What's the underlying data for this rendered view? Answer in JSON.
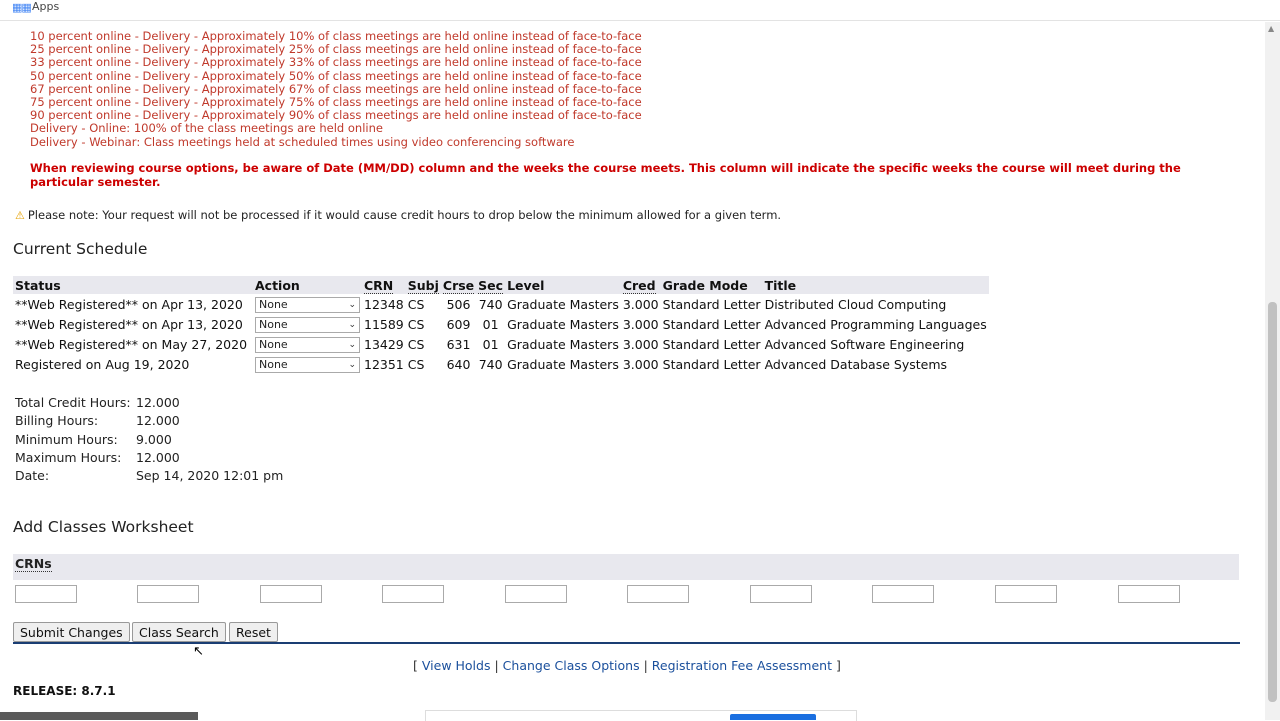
{
  "bookmarks_bar": {
    "apps_label": "Apps"
  },
  "delivery_lines": [
    "10 percent online - Delivery - Approximately 10% of class meetings are held online instead of face-to-face",
    "25 percent online - Delivery - Approximately 25% of class meetings are held online instead of face-to-face",
    "33 percent online - Delivery - Approximately 33% of class meetings are held online instead of face-to-face",
    "50 percent online - Delivery - Approximately 50% of class meetings are held online instead of face-to-face",
    "67 percent online - Delivery - Approximately 67% of class meetings are held online instead of face-to-face",
    "75 percent online - Delivery - Approximately 75% of class meetings are held online instead of face-to-face",
    "90 percent online - Delivery - Approximately 90% of class meetings are held online instead of face-to-face",
    "Delivery - Online: 100% of the class meetings are held online",
    "Delivery - Webinar: Class meetings held at scheduled times using video conferencing software"
  ],
  "warning_bold": "When reviewing course options, be aware of Date (MM/DD) column and the weeks the course meets. This column will indicate the specific weeks the course will meet during the particular semester.",
  "note": "Please note: Your request will not be processed if it would cause credit hours to drop below the minimum allowed for a given term.",
  "current_schedule": {
    "heading": "Current Schedule",
    "columns": [
      "Status",
      "Action",
      "CRN",
      "Subj",
      "Crse",
      "Sec",
      "Level",
      "Cred",
      "Grade Mode",
      "Title"
    ],
    "rows": [
      {
        "status": "**Web Registered** on Apr 13, 2020",
        "action": "None",
        "crn": "12348",
        "subj": "CS",
        "crse": "506",
        "sec": "740",
        "level": "Graduate Masters",
        "cred": "3.000",
        "grade_mode": "Standard Letter",
        "title": "Distributed Cloud Computing"
      },
      {
        "status": "**Web Registered** on Apr 13, 2020",
        "action": "None",
        "crn": "11589",
        "subj": "CS",
        "crse": "609",
        "sec": "01",
        "level": "Graduate Masters",
        "cred": "3.000",
        "grade_mode": "Standard Letter",
        "title": "Advanced Programming Languages"
      },
      {
        "status": "**Web Registered** on May 27, 2020",
        "action": "None",
        "crn": "13429",
        "subj": "CS",
        "crse": "631",
        "sec": "01",
        "level": "Graduate Masters",
        "cred": "3.000",
        "grade_mode": "Standard Letter",
        "title": "Advanced Software Engineering"
      },
      {
        "status": "Registered on Aug 19, 2020",
        "action": "None",
        "crn": "12351",
        "subj": "CS",
        "crse": "640",
        "sec": "740",
        "level": "Graduate Masters",
        "cred": "3.000",
        "grade_mode": "Standard Letter",
        "title": "Advanced Database Systems"
      }
    ]
  },
  "hours": {
    "total_label": "Total Credit Hours:",
    "total": "12.000",
    "billing_label": "Billing Hours:",
    "billing": "12.000",
    "minimum_label": "Minimum Hours:",
    "minimum": "9.000",
    "maximum_label": "Maximum Hours:",
    "maximum": "12.000",
    "date_label": "Date:",
    "date": "Sep 14, 2020 12:01 pm"
  },
  "worksheet": {
    "heading": "Add Classes Worksheet",
    "crns_label": "CRNs",
    "crn_values": [
      "",
      "",
      "",
      "",
      "",
      "",
      "",
      "",
      "",
      ""
    ]
  },
  "buttons": {
    "submit": "Submit Changes",
    "class_search": "Class Search",
    "reset": "Reset"
  },
  "footer": {
    "open_bracket": "[",
    "close_bracket": "]",
    "separator": "|",
    "view_holds": "View Holds",
    "change_class_options": "Change Class Options",
    "registration_fee": "Registration Fee Assessment"
  },
  "release": "RELEASE: 8.7.1",
  "colors": {
    "delivery_text": "#c0392b",
    "warning_text": "#cc0000",
    "rule": "#1a3d73",
    "link": "#1a4f9c"
  }
}
